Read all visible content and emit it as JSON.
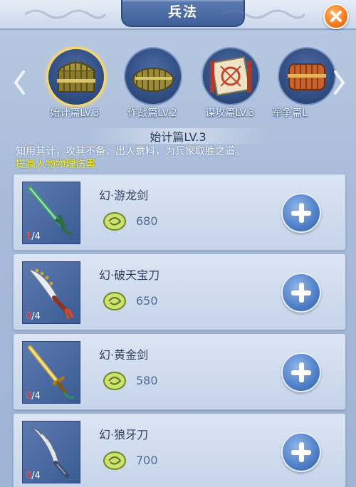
{
  "header": {
    "title": "兵法"
  },
  "books": [
    {
      "label": "始计篇LV.3",
      "selected": true
    },
    {
      "label": "作战篇LV.2",
      "selected": false
    },
    {
      "label": "谋攻篇LV.3",
      "selected": false
    },
    {
      "label": "军争篇L",
      "selected": false
    }
  ],
  "detail": {
    "title": "始计篇LV.3",
    "description": "知用其计，攻其不备，出人意料，为兵家取胜之道。",
    "effect": "提高人物物理伤害"
  },
  "weapons": [
    {
      "name": "幻·游龙剑",
      "have": "1",
      "need": "/4",
      "cost": "680"
    },
    {
      "name": "幻·破天宝刀",
      "have": "0",
      "need": "/4",
      "cost": "650"
    },
    {
      "name": "幻·黄金剑",
      "have": "0",
      "need": "/4",
      "cost": "580"
    },
    {
      "name": "幻·狼牙刀",
      "have": "0",
      "need": "/4",
      "cost": "700"
    }
  ],
  "colors": {
    "accent_orange": "#f07a1f",
    "effect_yellow": "#f7ef46",
    "count_red": "#ff4a3a",
    "panel_blue": "#3a5a93"
  },
  "icons": [
    "close-icon",
    "chevron-left-icon",
    "chevron-right-icon",
    "jade-token-icon",
    "plus-icon"
  ]
}
